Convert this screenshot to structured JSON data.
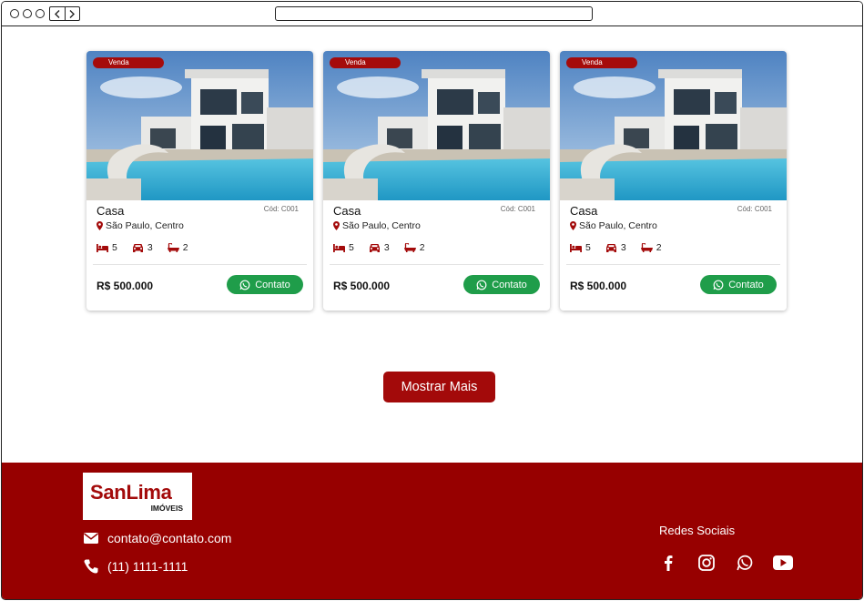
{
  "browser": {
    "url": ""
  },
  "listings": [
    {
      "badge": "Venda",
      "title": "Casa",
      "code": "Cód: C001",
      "location": "São Paulo, Centro",
      "bedrooms": "5",
      "garages": "3",
      "bathrooms": "2",
      "price": "R$ 500.000",
      "contact_label": "Contato"
    },
    {
      "badge": "Venda",
      "title": "Casa",
      "code": "Cód: C001",
      "location": "São Paulo, Centro",
      "bedrooms": "5",
      "garages": "3",
      "bathrooms": "2",
      "price": "R$ 500.000",
      "contact_label": "Contato"
    },
    {
      "badge": "Venda",
      "title": "Casa",
      "code": "Cód: C001",
      "location": "São Paulo, Centro",
      "bedrooms": "5",
      "garages": "3",
      "bathrooms": "2",
      "price": "R$ 500.000",
      "contact_label": "Contato"
    }
  ],
  "show_more_label": "Mostrar Mais",
  "footer": {
    "logo_main": "SanLima",
    "logo_sub": "IMÓVEIS",
    "email": "contato@contato.com",
    "phone": "(11) 1111-1111",
    "social_title": "Redes Sociais",
    "social_icons": [
      "facebook-icon",
      "instagram-icon",
      "whatsapp-icon",
      "youtube-icon"
    ]
  },
  "colors": {
    "brand": "#970000",
    "badge": "#a50b0b",
    "contact": "#1f9d4a"
  }
}
